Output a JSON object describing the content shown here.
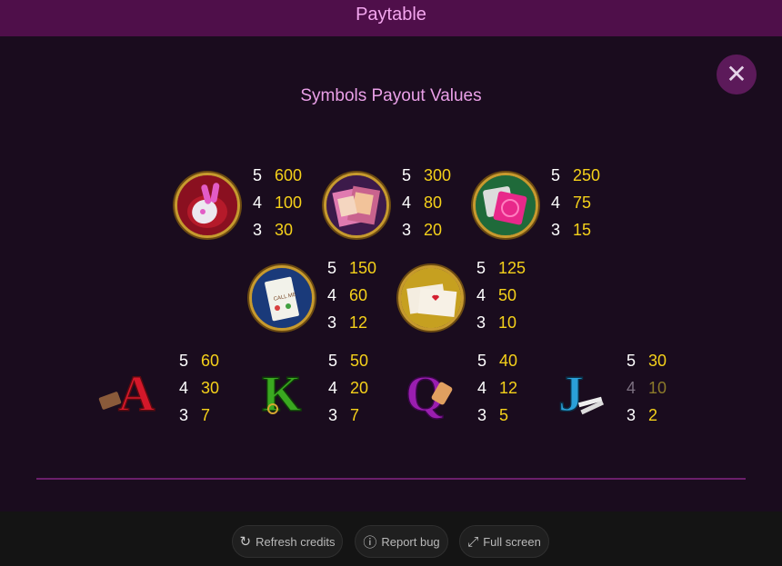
{
  "header": {
    "title": "Paytable"
  },
  "close_icon": "close-icon",
  "section_title": "Symbols Payout Values",
  "symbols": {
    "vibrator": {
      "icon": "vibrator-icon",
      "pays": [
        {
          "count": "5",
          "value": "600"
        },
        {
          "count": "4",
          "value": "100"
        },
        {
          "count": "3",
          "value": "30"
        }
      ]
    },
    "magazine": {
      "icon": "magazine-icon",
      "pays": [
        {
          "count": "5",
          "value": "300"
        },
        {
          "count": "4",
          "value": "80"
        },
        {
          "count": "3",
          "value": "20"
        }
      ]
    },
    "condom": {
      "icon": "condom-icon",
      "pays": [
        {
          "count": "5",
          "value": "250"
        },
        {
          "count": "4",
          "value": "75"
        },
        {
          "count": "3",
          "value": "15"
        }
      ]
    },
    "card": {
      "icon": "business-card-icon",
      "card_text": "CALL ME",
      "pays": [
        {
          "count": "5",
          "value": "150"
        },
        {
          "count": "4",
          "value": "60"
        },
        {
          "count": "3",
          "value": "12"
        }
      ]
    },
    "envelope": {
      "icon": "love-letter-icon",
      "pays": [
        {
          "count": "5",
          "value": "125"
        },
        {
          "count": "4",
          "value": "50"
        },
        {
          "count": "3",
          "value": "10"
        }
      ]
    },
    "letter_a": {
      "icon": "letter-a-icon",
      "letter": "A",
      "pays": [
        {
          "count": "5",
          "value": "60"
        },
        {
          "count": "4",
          "value": "30"
        },
        {
          "count": "3",
          "value": "7"
        }
      ]
    },
    "letter_k": {
      "icon": "letter-k-icon",
      "letter": "K",
      "pays": [
        {
          "count": "5",
          "value": "50"
        },
        {
          "count": "4",
          "value": "20"
        },
        {
          "count": "3",
          "value": "7"
        }
      ]
    },
    "letter_q": {
      "icon": "letter-q-icon",
      "letter": "Q",
      "pays": [
        {
          "count": "5",
          "value": "40"
        },
        {
          "count": "4",
          "value": "12"
        },
        {
          "count": "3",
          "value": "5"
        }
      ]
    },
    "letter_j": {
      "icon": "letter-j-icon",
      "letter": "J",
      "pays": [
        {
          "count": "5",
          "value": "30"
        },
        {
          "count": "4",
          "value": "10"
        },
        {
          "count": "3",
          "value": "2"
        }
      ]
    }
  },
  "footer": {
    "refresh": {
      "label": "Refresh credits",
      "icon": "refresh-icon"
    },
    "report": {
      "label": "Report bug",
      "icon": "alert-icon"
    },
    "fullscreen": {
      "label": "Full screen",
      "icon": "fullscreen-icon"
    }
  },
  "colors": {
    "header_bg": "#4f0f4a",
    "title_pink": "#f3a6ee",
    "payout_yellow": "#f5d11a",
    "background": "#1a0c1e",
    "icon_gold_ring": "#c79a2e"
  }
}
